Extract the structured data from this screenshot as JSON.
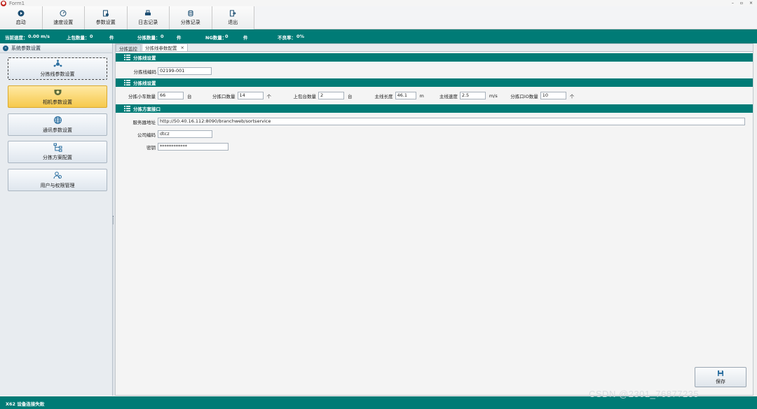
{
  "window": {
    "title": "Form1",
    "controls": {
      "minimize": "–",
      "maximize": "▫",
      "close": "×"
    }
  },
  "toolbar": {
    "buttons": [
      {
        "label": "启动",
        "icon": "play-icon"
      },
      {
        "label": "速度设置",
        "icon": "speedometer-icon"
      },
      {
        "label": "参数设置",
        "icon": "settings-icon"
      },
      {
        "label": "日志记录",
        "icon": "printer-icon"
      },
      {
        "label": "分拣记录",
        "icon": "database-icon"
      },
      {
        "label": "退出",
        "icon": "exit-icon"
      }
    ]
  },
  "status": {
    "speed_label": "当前速度：",
    "speed_value": "0.00",
    "speed_unit": "m/s",
    "uploaded_label": "上包数量：",
    "uploaded_value": "0",
    "uploaded_unit": "件",
    "sorted_label": "分拣数量：",
    "sorted_value": "0",
    "sorted_unit": "件",
    "ng_label": "NG数量：",
    "ng_value": "0",
    "ng_unit": "件",
    "fail_rate_label": "不良率：",
    "fail_rate_value": "0%"
  },
  "sidebar": {
    "header": "系统参数设置",
    "items": [
      {
        "label": "分拣线参数设置",
        "icon": "network-hub-icon"
      },
      {
        "label": "相机参数设置",
        "icon": "camera-icon"
      },
      {
        "label": "通讯参数设置",
        "icon": "globe-icon"
      },
      {
        "label": "分拣方案配置",
        "icon": "flowchart-icon"
      },
      {
        "label": "用户与权限管理",
        "icon": "users-icon"
      }
    ]
  },
  "tabs": [
    {
      "label": "分拣监控"
    },
    {
      "label": "分拣线参数配置",
      "close": "×"
    }
  ],
  "sections": {
    "line_setting": {
      "title": "分拣线设置",
      "code_label": "分拣线编码",
      "code_value": "02199-001"
    },
    "line_config": {
      "title": "分拣线设置",
      "car_count_label": "分拣小车数量",
      "car_count_value": "66",
      "car_count_unit": "台",
      "exit_count_label": "分拣口数量",
      "exit_count_value": "14",
      "exit_count_unit": "个",
      "feeder_count_label": "上包台数量",
      "feeder_count_value": "2",
      "feeder_count_unit": "台",
      "line_length_label": "主线长度",
      "line_length_value": "46.1",
      "line_length_unit": "m",
      "line_speed_label": "主线速度",
      "line_speed_value": "2.5",
      "line_speed_unit": "m/s",
      "exit_io_label": "分拣口IO数量",
      "exit_io_value": "10",
      "exit_io_unit": "个"
    },
    "interface": {
      "title": "分拣方案接口",
      "server_label": "服务器地址",
      "server_value": "http://50.40.16.112:8090/branchweb/sortservice",
      "company_label": "公司编码",
      "company_value": "dtcz",
      "key_label": "密钥",
      "key_value": "************"
    }
  },
  "save_button": {
    "label": "保存"
  },
  "bottom": {
    "message": "X62 设备连接失败"
  },
  "watermark": "CSDN @2301_76877235"
}
